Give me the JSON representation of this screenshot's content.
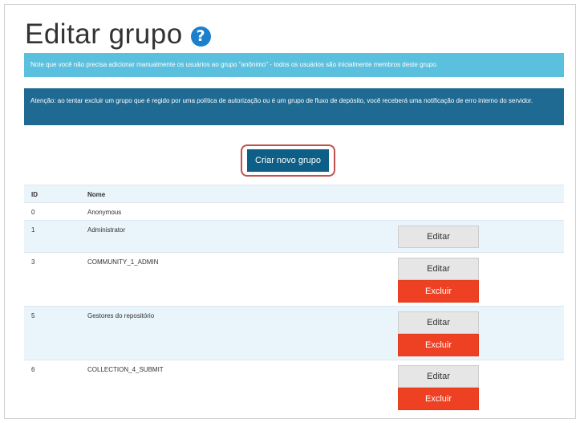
{
  "page": {
    "title": "Editar grupo",
    "help_icon": "question-circle-icon"
  },
  "alerts": {
    "info": "Note que você não precisa adicionar manualmente os usuários ao grupo \"anônimo\" - todos os usuários são inicialmente membros deste grupo.",
    "warning": "Atenção: ao tentar excluir um grupo que é regido por uma política de autorização ou é um grupo de fluxo de depósito, você receberá uma notificação de erro interno do servidor."
  },
  "actions": {
    "create_label": "Criar novo grupo"
  },
  "table": {
    "headers": {
      "id": "ID",
      "name": "Nome"
    },
    "rows": [
      {
        "id": "0",
        "name": "Anonymous"
      },
      {
        "id": "1",
        "name": "Administrator",
        "edit": "Editar"
      },
      {
        "id": "3",
        "name": "COMMUNITY_1_ADMIN",
        "edit": "Editar",
        "delete": "Excluir"
      },
      {
        "id": "5",
        "name": "Gestores do repositório",
        "edit": "Editar",
        "delete": "Excluir"
      },
      {
        "id": "6",
        "name": "COLLECTION_4_SUBMIT",
        "edit": "Editar",
        "delete": "Excluir"
      }
    ]
  },
  "colors": {
    "info": "#5bc0de",
    "warning": "#1f6a93",
    "primary": "#0e5f87",
    "danger": "#ee4123",
    "highlight": "#c0504d"
  }
}
